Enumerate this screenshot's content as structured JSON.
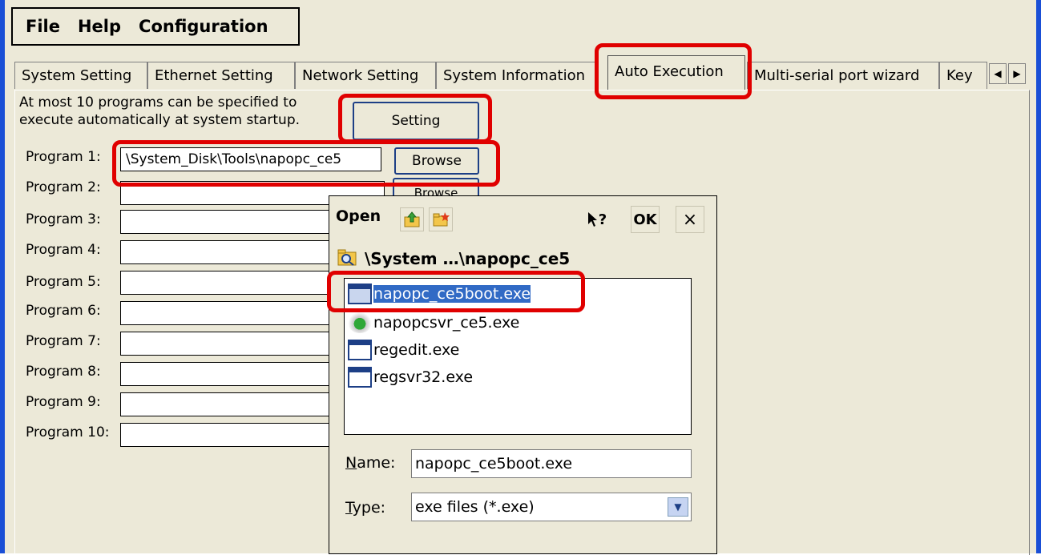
{
  "menu": {
    "file": "File",
    "help": "Help",
    "configuration": "Configuration"
  },
  "tabs": [
    {
      "label": "System Setting"
    },
    {
      "label": "Ethernet Setting"
    },
    {
      "label": "Network Setting"
    },
    {
      "label": "System Information"
    },
    {
      "label": "Auto Execution"
    },
    {
      "label": "Multi-serial port wizard"
    },
    {
      "label": "Key"
    }
  ],
  "tab_scroll": {
    "left": "◀",
    "right": "▶"
  },
  "intro": {
    "line1": "At most 10 programs can be specified to",
    "line2": "execute automatically at system startup."
  },
  "setting_button": "Setting",
  "browse_label": "Browse",
  "programs": [
    {
      "label": "Program 1:",
      "value": "\\System_Disk\\Tools\\napopc_ce5"
    },
    {
      "label": "Program 2:",
      "value": ""
    },
    {
      "label": "Program 3:",
      "value": ""
    },
    {
      "label": "Program 4:",
      "value": ""
    },
    {
      "label": "Program 5:",
      "value": ""
    },
    {
      "label": "Program 6:",
      "value": ""
    },
    {
      "label": "Program 7:",
      "value": ""
    },
    {
      "label": "Program 8:",
      "value": ""
    },
    {
      "label": "Program 9:",
      "value": ""
    },
    {
      "label": "Program 10:",
      "value": ""
    }
  ],
  "dialog": {
    "title": "Open",
    "help_btn": "?",
    "ok_btn": "OK",
    "close_btn": "×",
    "path": "\\System …\\napopc_ce5",
    "files": [
      {
        "name": "napopc_ce5boot.exe",
        "icon": "exe-window-icon",
        "selected": true
      },
      {
        "name": "napopcsvr_ce5.exe",
        "icon": "service-gear-icon",
        "selected": false
      },
      {
        "name": "regedit.exe",
        "icon": "exe-window-icon",
        "selected": false
      },
      {
        "name": "regsvr32.exe",
        "icon": "exe-window-icon",
        "selected": false
      }
    ],
    "name_label_ul": "N",
    "name_label_rest": "ame:",
    "name_value": "napopc_ce5boot.exe",
    "type_label_ul": "T",
    "type_label_rest": "ype:",
    "type_value": "exe files (*.exe)",
    "dropdown_arrow": "▼"
  },
  "colors": {
    "highlight_red": "#e00000",
    "selection_blue": "#316ac5",
    "face": "#ece9d8"
  }
}
